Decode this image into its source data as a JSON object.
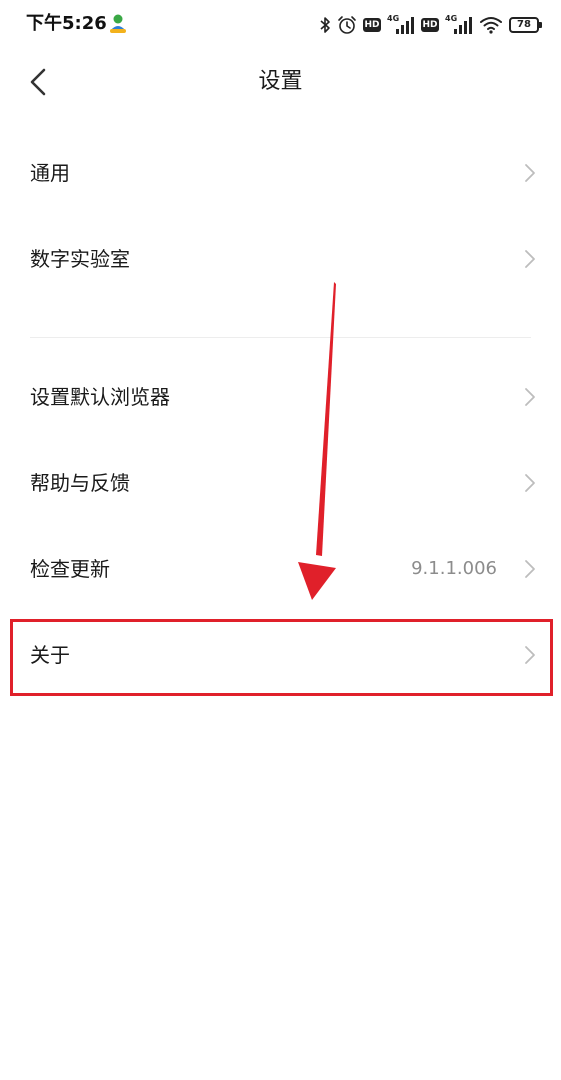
{
  "status_bar": {
    "time": "下午5:26",
    "network_1": "4G",
    "network_2": "4G",
    "hd_label": "HD",
    "battery": "78",
    "icons": [
      "bluetooth-icon",
      "alarm-icon",
      "hd-icon",
      "signal-icon",
      "hd-icon",
      "signal-icon",
      "wifi-icon",
      "battery-icon"
    ]
  },
  "header": {
    "title": "设置",
    "back_icon": "chevron-left-icon"
  },
  "settings": {
    "general": "通用",
    "digital_lab": "数字实验室",
    "default_browser": "设置默认浏览器",
    "help_feedback": "帮助与反馈",
    "check_update": "检查更新",
    "version": "9.1.1.006",
    "about": "关于"
  },
  "colors": {
    "highlight": "#e0202a",
    "chevron": "#bdbdbd",
    "value_text": "#8c8c8c"
  }
}
